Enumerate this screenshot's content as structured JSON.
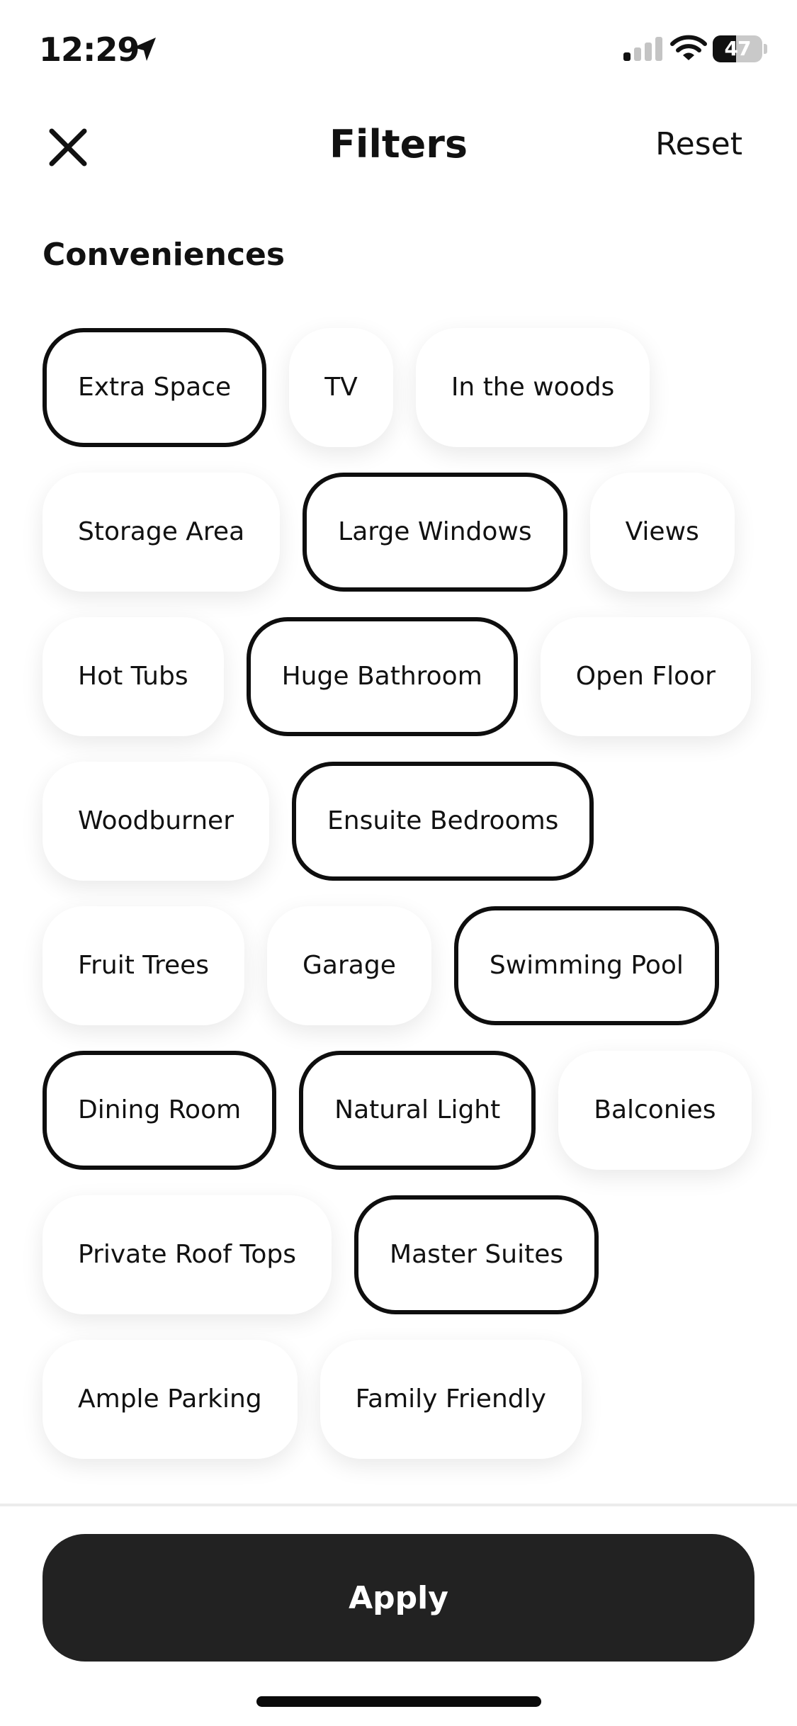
{
  "status_bar": {
    "time": "12:29",
    "battery_level": "47",
    "battery_fraction": 0.47,
    "icons": [
      "location-arrow-icon",
      "signal-icon",
      "wifi-icon",
      "battery-icon"
    ]
  },
  "header": {
    "title": "Filters",
    "reset_label": "Reset",
    "close_icon": "close-icon"
  },
  "section": {
    "title": "Conveniences"
  },
  "options": [
    {
      "label": "Extra Space",
      "selected": true
    },
    {
      "label": "TV",
      "selected": false
    },
    {
      "label": "In the woods",
      "selected": false
    },
    {
      "label": "Storage Area",
      "selected": false
    },
    {
      "label": "Large Windows",
      "selected": true
    },
    {
      "label": "Views",
      "selected": false
    },
    {
      "label": "Hot Tubs",
      "selected": false
    },
    {
      "label": "Huge Bathroom",
      "selected": true
    },
    {
      "label": "Open Floor",
      "selected": false
    },
    {
      "label": "Woodburner",
      "selected": false
    },
    {
      "label": "Ensuite Bedrooms",
      "selected": true
    },
    {
      "label": "Fruit Trees",
      "selected": false
    },
    {
      "label": "Garage",
      "selected": false
    },
    {
      "label": "Swimming Pool",
      "selected": true
    },
    {
      "label": "Dining Room",
      "selected": true
    },
    {
      "label": "Natural Light",
      "selected": true
    },
    {
      "label": "Balconies",
      "selected": false
    },
    {
      "label": "Private Roof Tops",
      "selected": false
    },
    {
      "label": "Master Suites",
      "selected": true
    },
    {
      "label": "Ample Parking",
      "selected": false
    },
    {
      "label": "Family Friendly",
      "selected": false
    }
  ],
  "footer": {
    "apply_label": "Apply"
  },
  "colors": {
    "background": "#ffffff",
    "text": "#111111",
    "selected_border": "#0e0e0e",
    "apply_background": "#222222",
    "apply_text": "#ffffff"
  }
}
